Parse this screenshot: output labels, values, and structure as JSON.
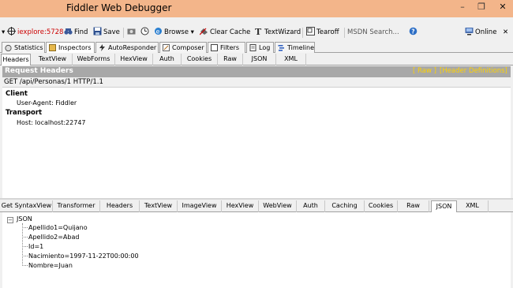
{
  "window": {
    "title": "Fiddler Web Debugger"
  },
  "toolbar": {
    "process": "iexplore:5728",
    "find": "Find",
    "save": "Save",
    "browse": "Browse",
    "clear_cache": "Clear Cache",
    "textwizard": "TextWizard",
    "tearoff": "Tearoff",
    "search_placeholder": "MSDN Search...",
    "online": "Online"
  },
  "main_tabs": [
    "Statistics",
    "Inspectors",
    "AutoResponder",
    "Composer",
    "Filters",
    "Log",
    "Timeline"
  ],
  "request_tabs": [
    "Headers",
    "TextView",
    "WebForms",
    "HexView",
    "Auth",
    "Cookies",
    "Raw",
    "JSON",
    "XML"
  ],
  "request": {
    "panel_title": "Request Headers",
    "raw_link": "[ Raw ]",
    "defs_link": "[Header Definitions]",
    "request_line": "GET /api/Personas/1 HTTP/1.1",
    "groups": [
      {
        "name": "Client",
        "headers": [
          "User-Agent: Fiddler"
        ]
      },
      {
        "name": "Transport",
        "headers": [
          "Host: localhost:22747"
        ]
      }
    ]
  },
  "response_tabs": [
    "Get SyntaxView",
    "Transformer",
    "Headers",
    "TextView",
    "ImageView",
    "HexView",
    "WebView",
    "Auth",
    "Caching",
    "Cookies",
    "Raw",
    "JSON",
    "XML"
  ],
  "json_tree": {
    "root": "JSON",
    "expander": "−",
    "items": [
      "Apellido1=Quijano",
      "Apellido2=Abad",
      "Id=1",
      "Nacimiento=1997-11-22T00:00:00",
      "Nombre=Juan"
    ]
  },
  "colors": {
    "titlebar": "#f3b58a",
    "panel_header": "#a8a8a8",
    "header_links": "#ffd200"
  }
}
